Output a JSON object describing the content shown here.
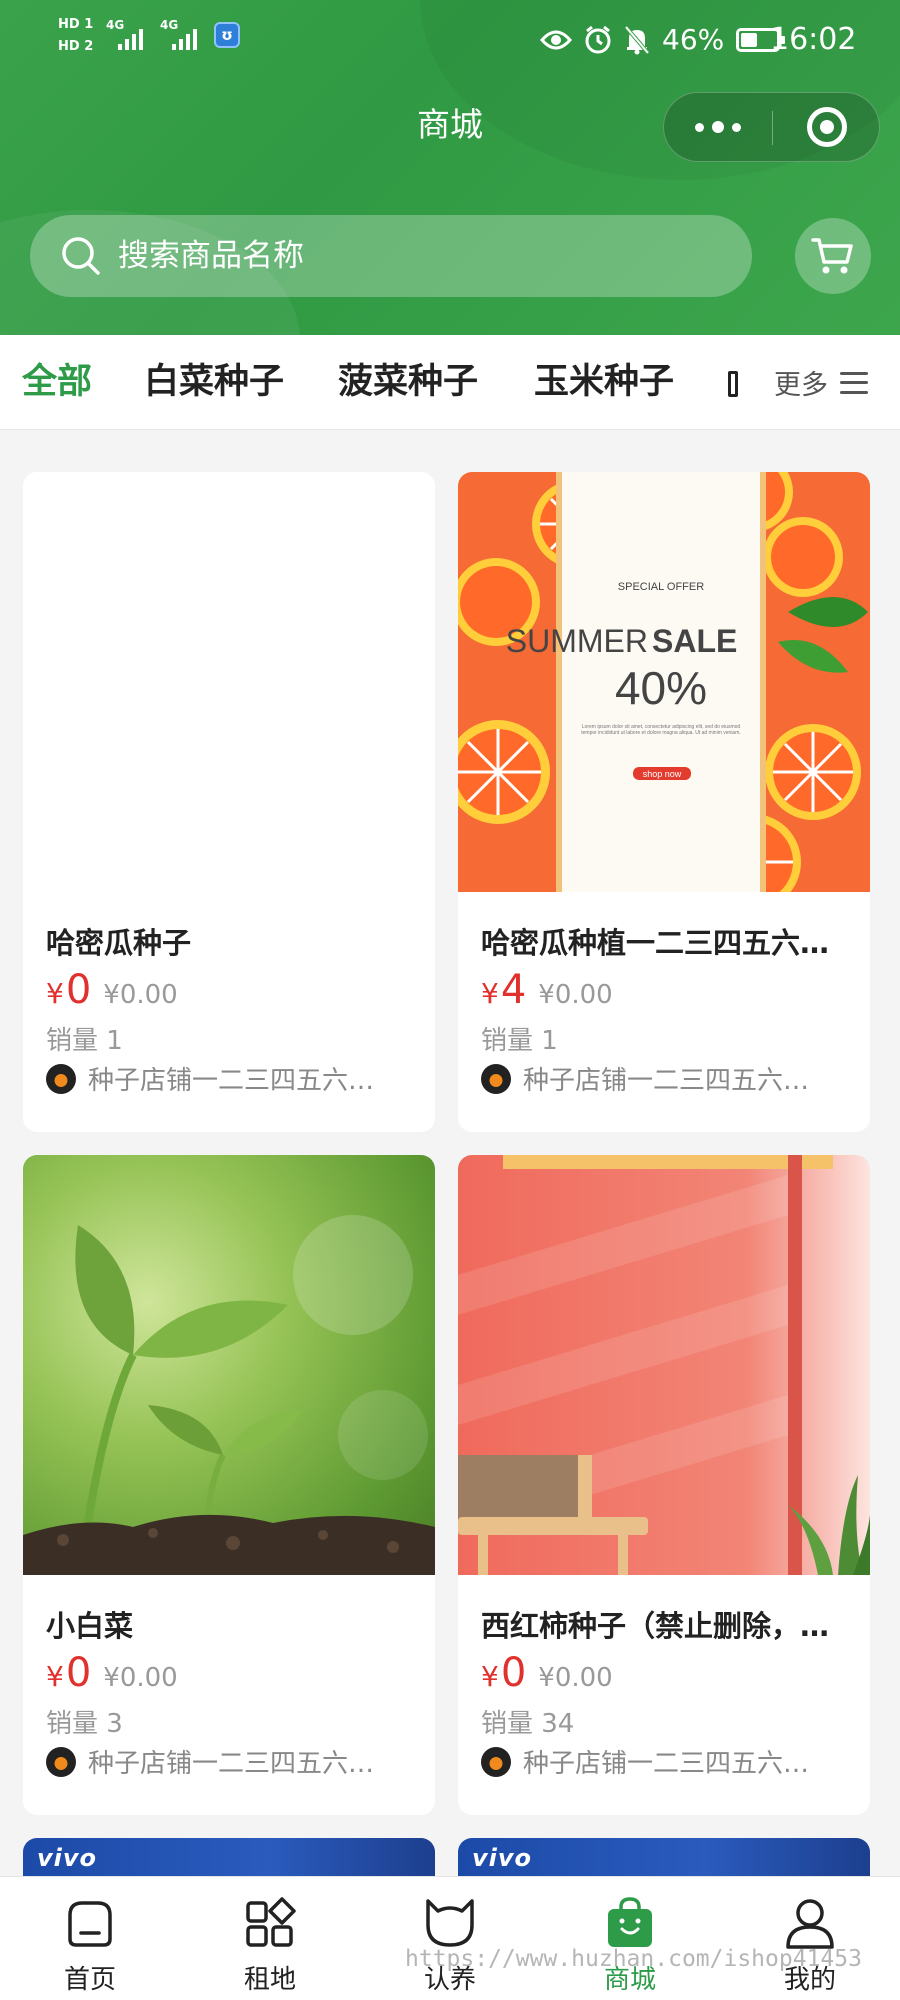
{
  "status_bar": {
    "hd1": "HD 1",
    "hd2": "HD 2",
    "signal1": "4G",
    "signal2": "4G",
    "battery_percent": "46%",
    "battery_level": 0.46,
    "time": "16:02"
  },
  "nav": {
    "title": "商城",
    "more_icon": "more-dots-icon",
    "close_icon": "target-icon"
  },
  "search": {
    "placeholder": "搜索商品名称",
    "icon": "search-icon",
    "cart_icon": "cart-icon"
  },
  "categories": {
    "items": [
      "全部",
      "白菜种子",
      "菠菜种子",
      "玉米种子"
    ],
    "active": "全部",
    "more_label": "更多"
  },
  "products": [
    {
      "name": "哈密瓜种子",
      "currency": "¥",
      "price": "0",
      "original_price": "¥0.00",
      "sales": "销量 1",
      "shop": "种子店铺一二三四五六…"
    },
    {
      "name": "哈密瓜种植一二三四五六…",
      "currency": "¥",
      "price": "4",
      "original_price": "¥0.00",
      "sales": "销量 1",
      "shop": "种子店铺一二三四五六…",
      "banner": {
        "special": "SPECIAL OFFER",
        "summer": "SUMMER",
        "sale": "SALE",
        "pct": "40%",
        "lorem": "Lorem ipsum dolor sit amet, consectetur adipiscing elit, sed do eiusmod tempor incididunt ut labore et dolore magna aliqua. Ut ad minim veniam.",
        "shop_btn": "shop now"
      }
    },
    {
      "name": "小白菜",
      "currency": "¥",
      "price": "0",
      "original_price": "¥0.00",
      "sales": "销量 3",
      "shop": "种子店铺一二三四五六…"
    },
    {
      "name": "西红柿种子（禁止删除，…",
      "currency": "¥",
      "price": "0",
      "original_price": "¥0.00",
      "sales": "销量 34",
      "shop": "种子店铺一二三四五六…"
    }
  ],
  "partial_cards": {
    "brand": "vivo"
  },
  "bottom_nav": {
    "items": [
      {
        "label": "首页",
        "icon": "home-icon"
      },
      {
        "label": "租地",
        "icon": "grid-icon"
      },
      {
        "label": "认养",
        "icon": "cat-icon"
      },
      {
        "label": "商城",
        "icon": "shopping-bag-icon"
      },
      {
        "label": "我的",
        "icon": "user-icon"
      }
    ],
    "active": "商城"
  },
  "watermark": "https://www.huzhan.com/ishop41453",
  "colors": {
    "primary": "#2e9b48",
    "price": "#e0312d"
  }
}
